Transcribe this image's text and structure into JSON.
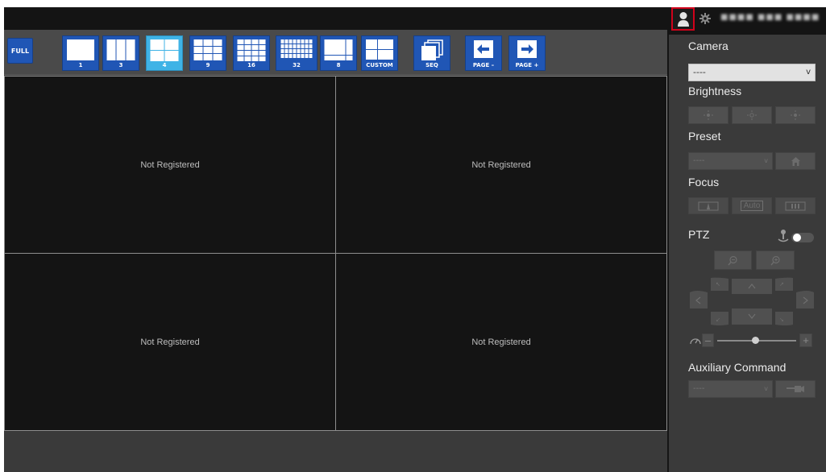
{
  "topbar": {
    "user_name": "■■■■ ■■■ ■■■■■"
  },
  "toolbar": {
    "buttons": [
      {
        "id": "full",
        "label": "FULL"
      },
      {
        "id": "layout-1",
        "label": "1"
      },
      {
        "id": "layout-3",
        "label": "3"
      },
      {
        "id": "layout-4",
        "label": "4",
        "active": true
      },
      {
        "id": "layout-9",
        "label": "9"
      },
      {
        "id": "layout-16",
        "label": "16"
      },
      {
        "id": "layout-32",
        "label": "32"
      },
      {
        "id": "layout-8",
        "label": "8"
      },
      {
        "id": "layout-custom",
        "label": "CUSTOM"
      },
      {
        "id": "seq",
        "label": "SEQ"
      },
      {
        "id": "page-prev",
        "label": "PAGE –"
      },
      {
        "id": "page-next",
        "label": "PAGE +"
      }
    ]
  },
  "grid": {
    "cells": [
      {
        "text": "Not Registered"
      },
      {
        "text": "Not Registered"
      },
      {
        "text": "Not Registered"
      },
      {
        "text": "Not Registered"
      }
    ]
  },
  "panel": {
    "camera": {
      "title": "Camera",
      "value": "----",
      "arrow": "v"
    },
    "brightness": {
      "title": "Brightness"
    },
    "preset": {
      "title": "Preset",
      "value": "----",
      "arrow": "v"
    },
    "focus": {
      "title": "Focus",
      "auto_label": "Auto"
    },
    "ptz": {
      "title": "PTZ"
    },
    "auxiliary": {
      "title": "Auxiliary Command",
      "value": "----",
      "arrow": "v"
    }
  },
  "colors": {
    "toolbar_button": "#2056b5",
    "toolbar_button_active": "#3fb3e6",
    "highlight": "#d0021b"
  }
}
